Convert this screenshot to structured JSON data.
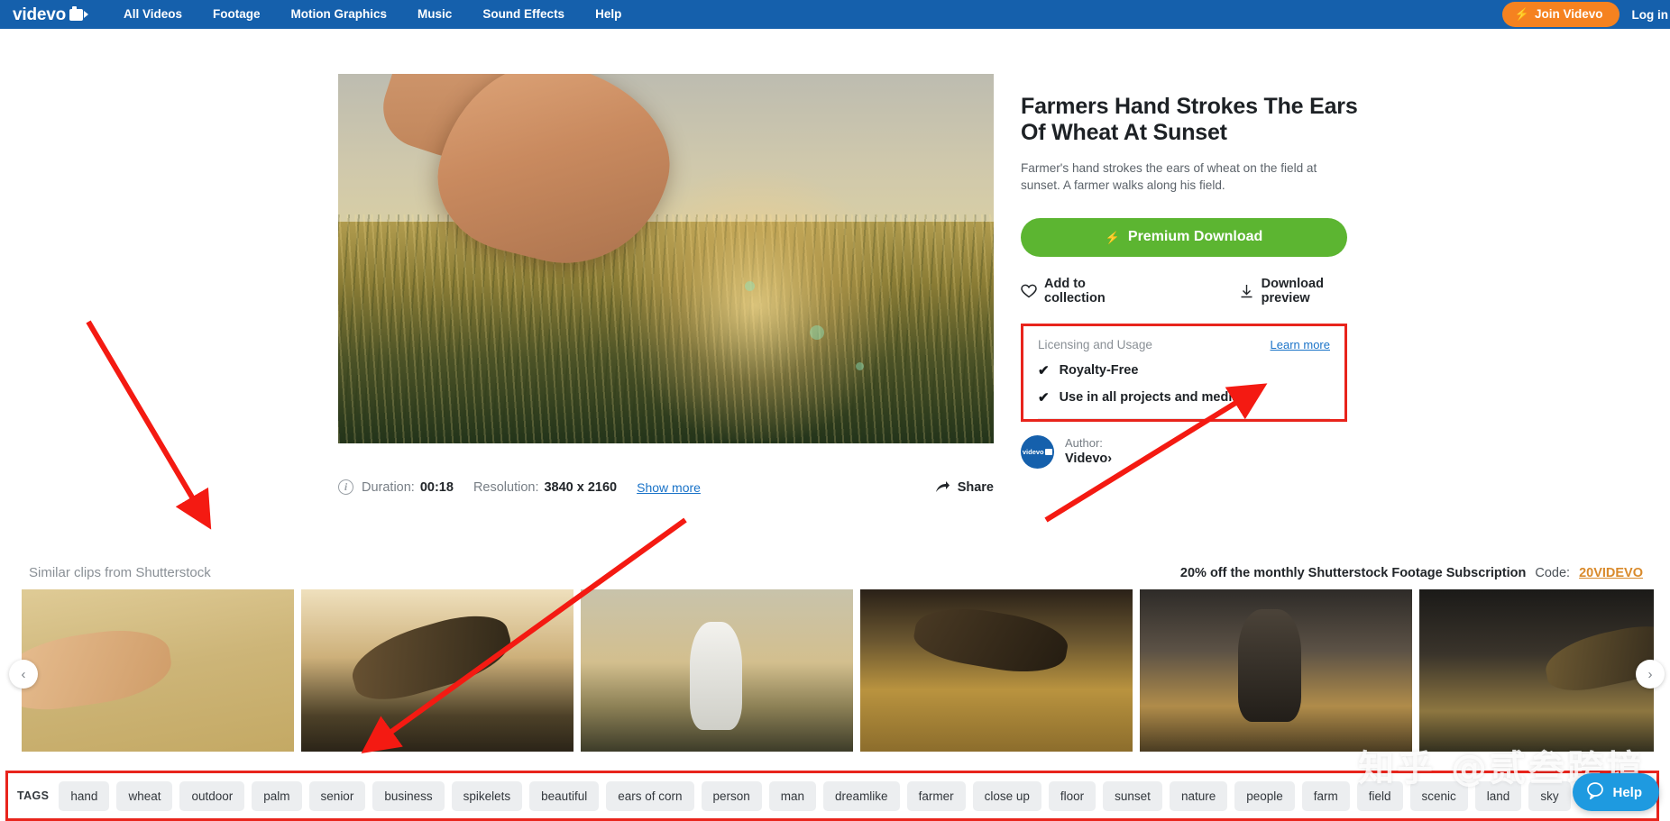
{
  "header": {
    "logo_text": "videvo",
    "logo_icon": "video-camera-icon",
    "nav": [
      {
        "label": "All Videos"
      },
      {
        "label": "Footage"
      },
      {
        "label": "Motion Graphics"
      },
      {
        "label": "Music"
      },
      {
        "label": "Sound Effects"
      },
      {
        "label": "Help"
      }
    ],
    "join_label": "Join Videvo",
    "join_icon": "lightning-bolt-icon",
    "login_label": "Log in",
    "brand_color": "#1560ac",
    "join_color": "#f58220"
  },
  "video": {
    "alt": "farmers hand strokes ears of wheat at sunset",
    "info_icon": "info-icon",
    "duration_label": "Duration:",
    "duration_value": "00:18",
    "resolution_label": "Resolution:",
    "resolution_value": "3840 x 2160",
    "show_more": "Show more",
    "share_label": "Share",
    "share_icon": "share-arrow-icon"
  },
  "detail": {
    "title": "Farmers Hand Strokes The Ears Of Wheat At Sunset",
    "description": "Farmer's hand strokes the ears of wheat on the field at sunset. A farmer walks along his field.",
    "download_label": "Premium Download",
    "download_icon": "lightning-bolt-icon",
    "download_color": "#5cb531",
    "add_collection_label": "Add to collection",
    "add_collection_icon": "heart-icon",
    "download_preview_label": "Download preview",
    "download_preview_icon": "download-arrow-icon",
    "license": {
      "heading": "Licensing and Usage",
      "learn_more": "Learn more",
      "items": [
        {
          "check_icon": "check-icon",
          "label": "Royalty-Free"
        },
        {
          "check_icon": "check-icon",
          "label": "Use in all projects and media."
        }
      ]
    },
    "author": {
      "avatar_icon": "videvo-avatar-icon",
      "avatar_text": "videvo",
      "label": "Author:",
      "name": "Videvo",
      "chevron": "›"
    }
  },
  "similar": {
    "heading": "Similar clips from Shutterstock",
    "promo_text": "20% off the monthly Shutterstock Footage Subscription",
    "promo_code_label": "Code:",
    "promo_code": "20VIDEVO",
    "prev_icon": "chevron-left-icon",
    "next_icon": "chevron-right-icon",
    "thumbnails": [
      {
        "alt": "hand brushing golden wheat field"
      },
      {
        "alt": "silhouette hand touching wheat at sunset"
      },
      {
        "alt": "man in white shirt walking through field at sunset"
      },
      {
        "alt": "hand over wheat ears golden field"
      },
      {
        "alt": "man in plaid shirt standing in field at sunset"
      },
      {
        "alt": "hand reaching through dark wheat stalks"
      }
    ]
  },
  "tags": {
    "label": "TAGS",
    "items": [
      "hand",
      "wheat",
      "outdoor",
      "palm",
      "senior",
      "business",
      "spikelets",
      "beautiful",
      "ears of corn",
      "person",
      "man",
      "dreamlike",
      "farmer",
      "close up",
      "floor",
      "sunset",
      "nature",
      "people",
      "farm",
      "field",
      "scenic",
      "land",
      "sky"
    ]
  },
  "help": {
    "label": "Help",
    "icon": "chat-bubble-icon",
    "color": "#1e9ae0"
  },
  "watermark": {
    "text": "知乎 @贰叁跨境"
  },
  "annotations": {
    "color": "#e8241c",
    "arrows": [
      {
        "name": "arrow-to-similar-clips"
      },
      {
        "name": "arrow-to-tags"
      },
      {
        "name": "arrow-to-licensing-box"
      }
    ]
  }
}
